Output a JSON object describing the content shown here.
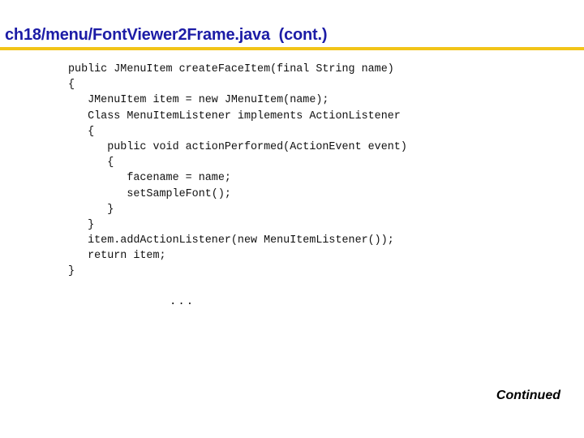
{
  "slide": {
    "title": "ch18/menu/FontViewer2Frame.java  (cont.)",
    "colors": {
      "title": "#1c1ca6",
      "rule": "#f2c418",
      "code": "#111111",
      "background": "#ffffff"
    },
    "code_lines": [
      "public JMenuItem createFaceItem(final String name)",
      "{",
      "   JMenuItem item = new JMenuItem(name);",
      "   Class MenuItemListener implements ActionListener",
      "   {",
      "      public void actionPerformed(ActionEvent event)",
      "      {",
      "         facename = name;",
      "         setSampleFont();",
      "      }",
      "   }",
      "   item.addActionListener(new MenuItemListener());",
      "   return item;",
      "}"
    ],
    "ellipsis": "...",
    "footer": "Continued"
  }
}
